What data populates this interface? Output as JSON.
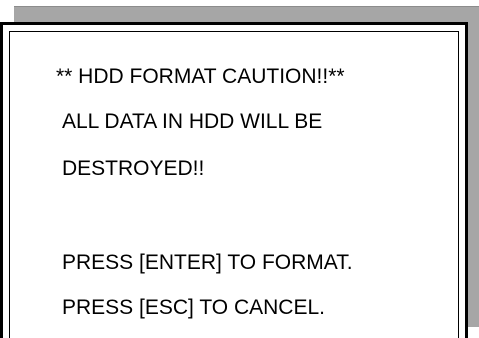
{
  "dialog": {
    "caution_title": "** HDD FORMAT CAUTION!!**",
    "warning_line_1": "ALL DATA IN HDD WILL BE",
    "warning_line_2": "DESTROYED!!",
    "enter_instruction": "PRESS [ENTER] TO FORMAT.",
    "esc_instruction": "PRESS [ESC] TO CANCEL."
  },
  "colors": {
    "background": "#ffffff",
    "shadow": "#a6a6a6",
    "border": "#000000",
    "text": "#000000"
  }
}
